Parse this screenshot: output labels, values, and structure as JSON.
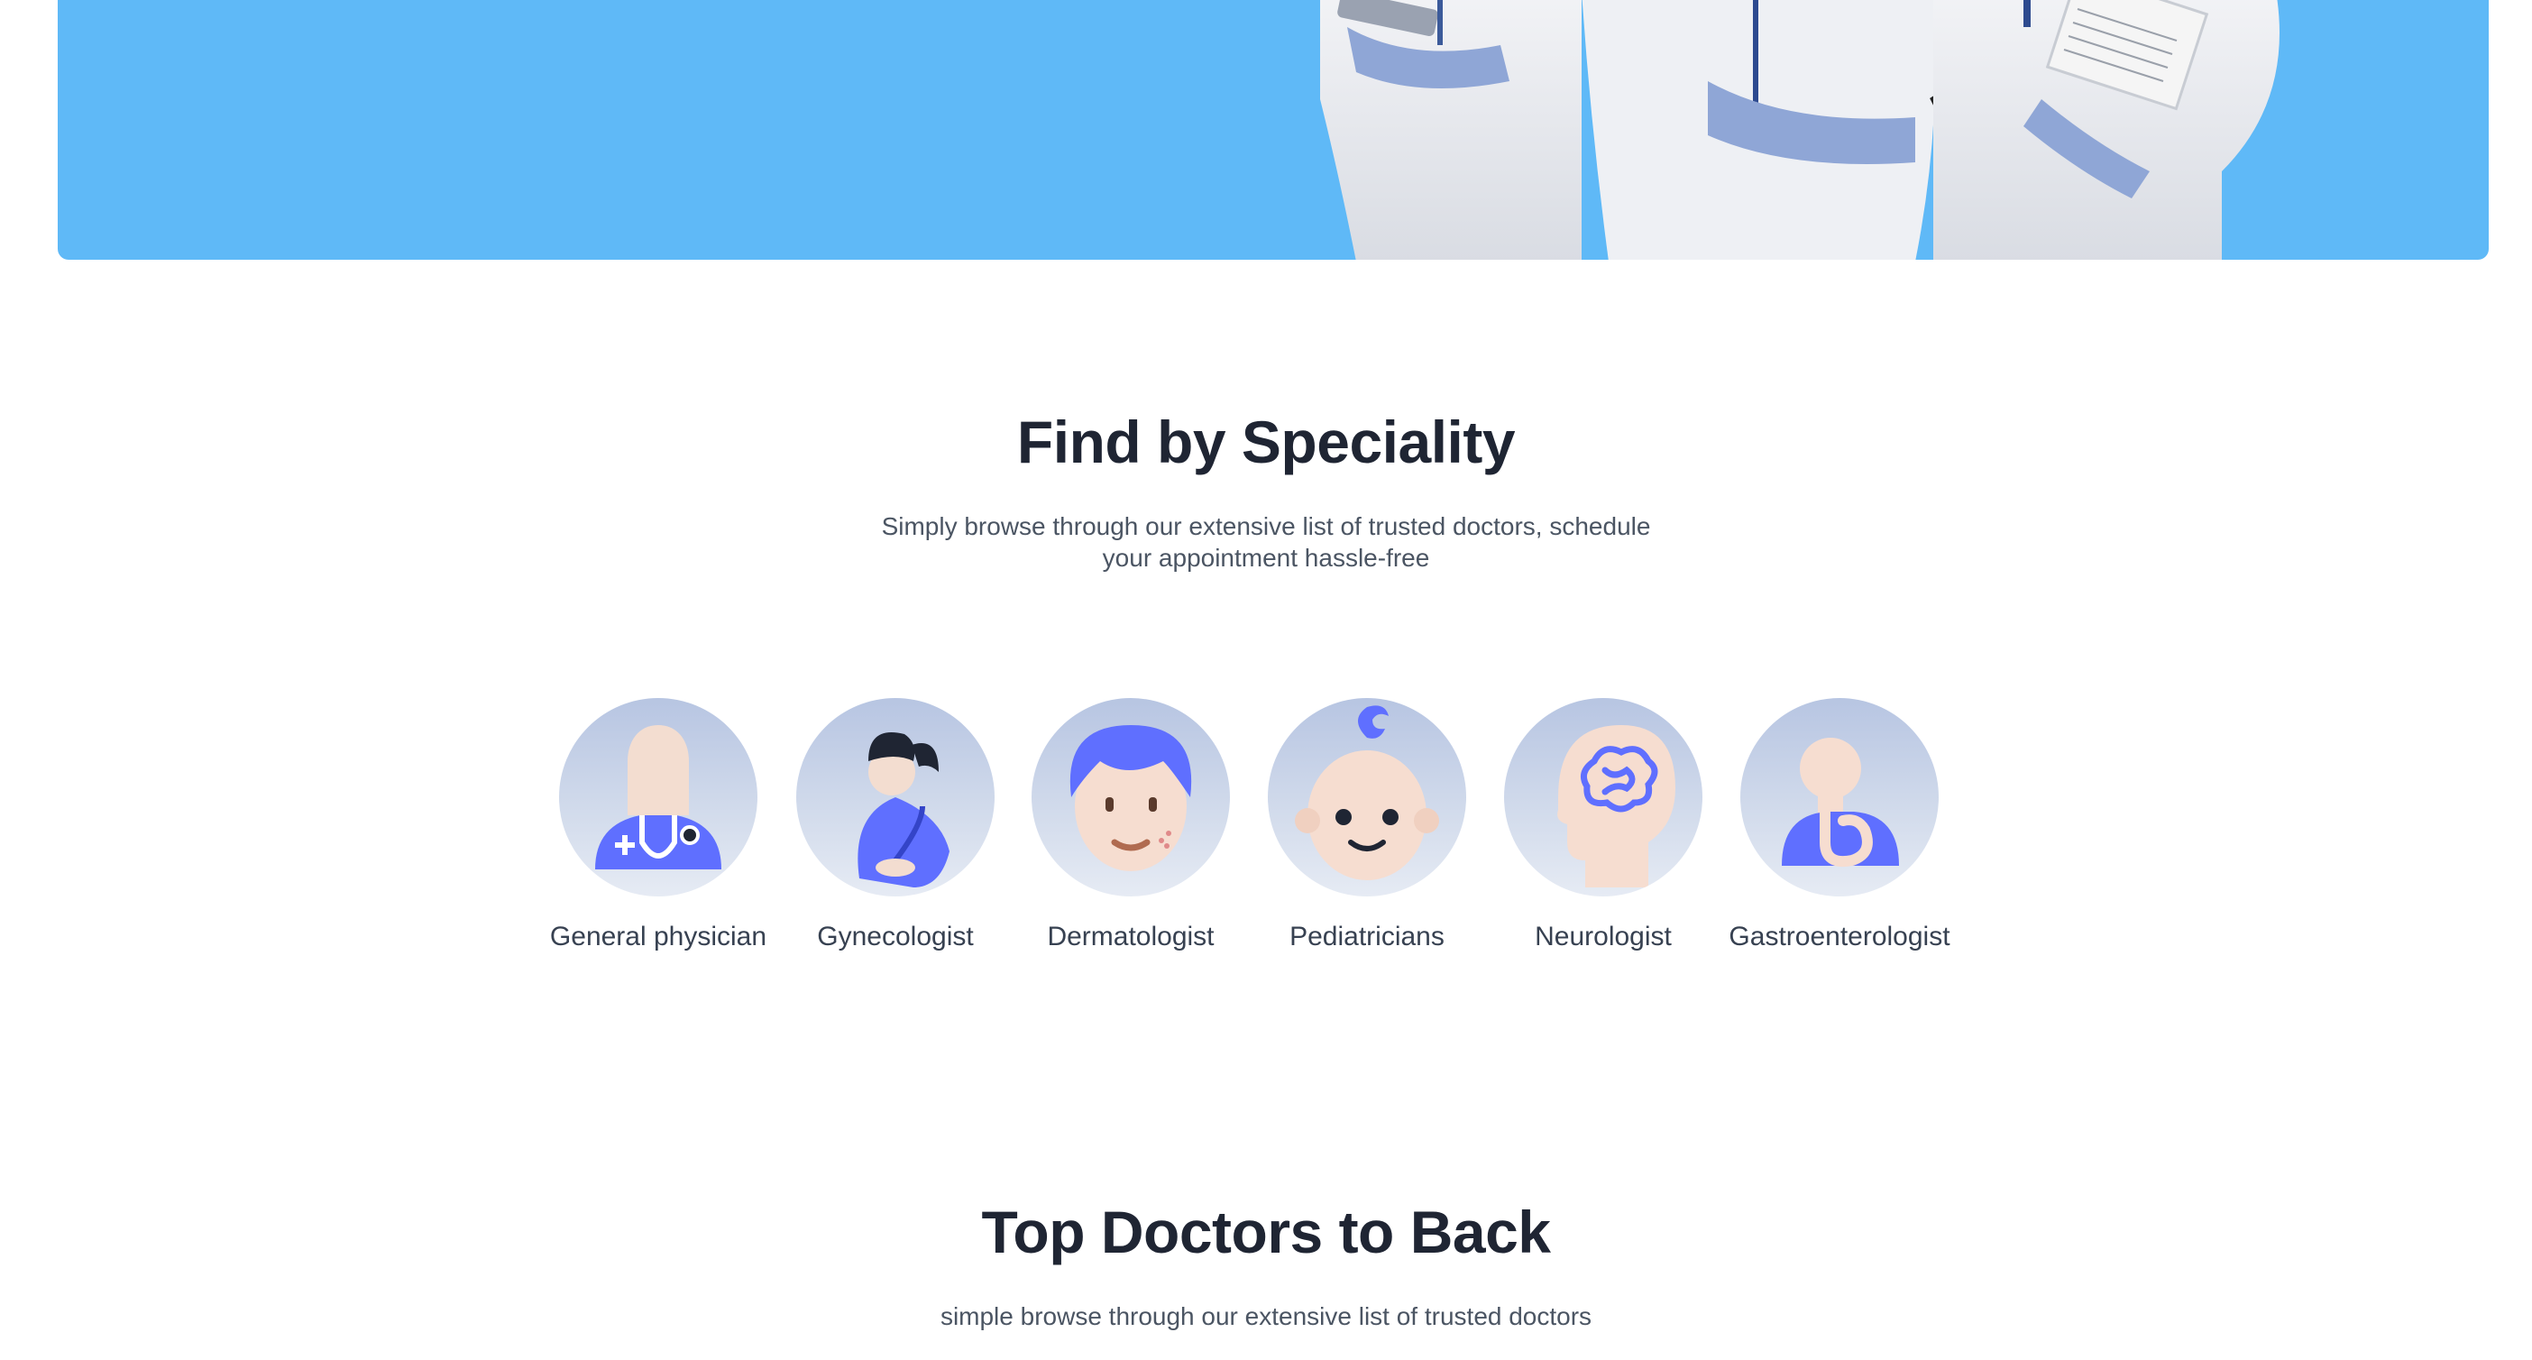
{
  "speciality": {
    "title": "Find by Speciality",
    "subtitle_line1": "Simply browse through our extensive list of trusted doctors, schedule",
    "subtitle_line2": "your appointment hassle-free",
    "items": [
      {
        "label": "General physician",
        "icon": "general-physician-icon"
      },
      {
        "label": "Gynecologist",
        "icon": "gynecologist-icon"
      },
      {
        "label": "Dermatologist",
        "icon": "dermatologist-icon"
      },
      {
        "label": "Pediatricians",
        "icon": "pediatrician-icon"
      },
      {
        "label": "Neurologist",
        "icon": "neurologist-icon"
      },
      {
        "label": "Gastroenterologist",
        "icon": "gastroenterologist-icon"
      }
    ]
  },
  "top_doctors": {
    "title": "Top Doctors to Back",
    "subtitle": "simple browse through our extensive list of trusted doctors"
  },
  "colors": {
    "hero_bg": "#5fb9f7",
    "accent": "#5f6fff",
    "heading": "#1f2533",
    "text": "#4b5563"
  }
}
